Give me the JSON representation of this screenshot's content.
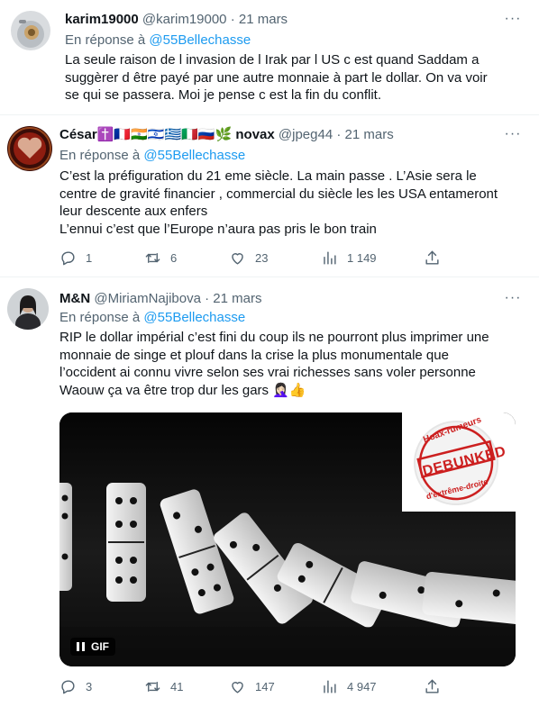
{
  "tweets": [
    {
      "name": "karim19000",
      "handle": "@karim19000",
      "time": "21 mars",
      "reply_prefix": "En réponse à",
      "reply_to": "@55Bellechasse",
      "lines": [
        "La seule  raison  de l invasion de l Irak  par l US c est quand  Saddam  a",
        "suggèrer  d être  payé par une autre  monnaie  à part  le dollar. On va voir",
        "se qui se passera. Moi je pense  c est la fin du conflit."
      ]
    },
    {
      "name": "César",
      "name_suffix": "novax",
      "flags": [
        "✝️",
        "🇫🇷",
        "🇮🇳",
        "🇮🇱",
        "🇬🇷",
        "🇮🇹",
        "🇷🇺",
        "🌿"
      ],
      "handle": "@jpeg44",
      "time": "21 mars",
      "reply_prefix": "En réponse à",
      "reply_to": "@55Bellechasse",
      "lines": [
        "C’est la préfiguration du 21 eme siècle. La main passe . L’Asie sera le",
        "centre de gravité financier , commercial du siècle les les USA entameront",
        "leur descente aux enfers",
        "L’ennui c’est que l’Europe n’aura pas pris le bon train"
      ],
      "stats": {
        "replies": "1",
        "retweets": "6",
        "likes": "23",
        "views": "1 149"
      }
    },
    {
      "name": "M&N",
      "handle": "@MiriamNajibova",
      "time": "21 mars",
      "reply_prefix": "En réponse à",
      "reply_to": "@55Bellechasse",
      "lines": [
        "RIP le dollar impérial c’est fini du coup ils ne pourront plus imprimer une",
        "monnaie de singe et plouf dans la crise la plus monumentale que",
        "l’occident ai connu vivre selon ses vrai richesses sans voler personne",
        "Waouw ça va être trop dur les gars 🤦🏻‍♀️👍"
      ],
      "media": {
        "badge": "GIF",
        "stamp_top": "Hoax-rumeurs",
        "stamp_middle": "DEBUNKED",
        "stamp_bottom": "d'extrême-droite"
      },
      "stats": {
        "replies": "3",
        "retweets": "41",
        "likes": "147",
        "views": "4 947"
      }
    }
  ],
  "more_label": "···",
  "dot": "·",
  "icons": [
    "reply-icon",
    "retweet-icon",
    "like-icon",
    "views-icon",
    "share-icon",
    "more-icon",
    "pause-icon"
  ],
  "colors": {
    "link": "#1d9bf0",
    "muted": "#536471",
    "text": "#0f1419",
    "stamp": "#cc1f1f"
  }
}
